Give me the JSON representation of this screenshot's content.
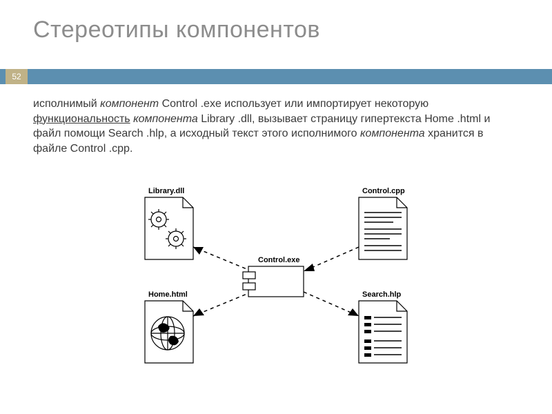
{
  "slide": {
    "title": "Стереотипы компонентов",
    "page_number": "52"
  },
  "body": {
    "p1_a": "исполнимый",
    "p1_b": "компонент",
    "p1_c": "Control .exe использует или импортирует некоторую",
    "p1_d": "функциональность",
    "p1_e": "компонента",
    "p1_f": "Library .dll, вызывает страницу гипертекста Home .html и файл помощи Search .hlp, а исходный текст этого исполнимого",
    "p1_g": "компонента",
    "p1_h": "хранится в файле Control .cpp."
  },
  "diagram": {
    "labels": {
      "library": "Library.dll",
      "control_cpp": "Control.cpp",
      "home": "Home.html",
      "search": "Search.hlp",
      "control_exe": "Control.exe"
    }
  }
}
